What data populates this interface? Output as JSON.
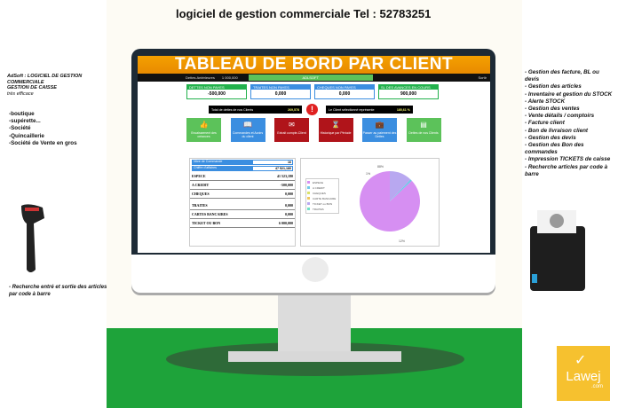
{
  "header": "logiciel de gestion commerciale Tel : 52783251",
  "left": {
    "intro": [
      "AdSoft : LOGICIEL DE GESTION",
      "COMMERCIALE",
      "GESTION DE CAISSE",
      "très efficace"
    ],
    "targets": [
      "-boutique",
      "-supérette...",
      "-Société",
      "-Quincaillerie",
      "-Société de Vente en gros"
    ],
    "scanner_text": "- Recherche  entré et sortie des articles par code à barre"
  },
  "right": {
    "features": [
      "- Gestion des facture, BL ou devis",
      "- Gestion des articles",
      "- Inventaire et gestion du STOCK",
      "- Alerte STOCK",
      "- Gestion des ventes",
      "- Vente détails / comptoirs",
      "- Facture client",
      "- Bon de livraison client",
      "- Gestion des devis",
      "- Gestion des Bon des commandes",
      "- Impression TICKETS de caisse",
      "- Recherche articles par code à barre"
    ]
  },
  "app": {
    "title": "TABLEAU DE BORD PAR CLIENT",
    "bar": {
      "label": "Dettes Antérieures",
      "value": "1 000,000",
      "client": "ADLSOFT",
      "exit": "Sortir"
    },
    "cards": [
      {
        "label": "DETTES NON PAYES",
        "value": "-500,000",
        "color": "#22b14c"
      },
      {
        "label": "TRAITES NON PAYES",
        "value": "0,000",
        "color": "#3b8ee0"
      },
      {
        "label": "CHEQUES NON PAYES",
        "value": "0,000",
        "color": "#3b8ee0"
      },
      {
        "label": "SL DES AVANCES EN COURS",
        "value": "900,000",
        "color": "#22b14c"
      }
    ],
    "total_label": "Total de dettes de nos Clients",
    "total_value": "269,578",
    "pct_label": "Le Client sélectionné représente",
    "pct_value": "185,61 %",
    "tiles": [
      {
        "icon": "thumbs-up",
        "label": "Encaissement des créances",
        "color": "#5cc25a"
      },
      {
        "icon": "book",
        "label": "Commandes et Avoirs du client",
        "color": "#3b8ee0"
      },
      {
        "icon": "envelope",
        "label": "Extrait compte-Client",
        "color": "#b0141a"
      },
      {
        "icon": "history",
        "label": "Historique par Période",
        "color": "#b0141a"
      },
      {
        "icon": "briefcase",
        "label": "Passer au paiement des Dettes",
        "color": "#3b8ee0"
      },
      {
        "icon": "chart",
        "label": "Dettes de nos Clients",
        "color": "#5cc25a"
      }
    ],
    "inputs": [
      {
        "label": "Nbre de Commande",
        "value": "16"
      },
      {
        "label": "Chiffre d'affaires",
        "value": "47 521,180"
      }
    ],
    "rows": [
      {
        "label": "ESPECE",
        "value": "41 523,180"
      },
      {
        "label": "A CREDIT",
        "value": "-500,000"
      },
      {
        "label": "CHEQUES",
        "value": "0,000"
      },
      {
        "label": "TRAITES",
        "value": "0,000"
      },
      {
        "label": "CARTES BANCAIRES",
        "value": "0,000"
      },
      {
        "label": "TICKET OU BON",
        "value": "6 000,000"
      }
    ],
    "chart_data": {
      "type": "pie",
      "categories": [
        "ESPECE",
        "A CREDIT",
        "CHEQUES",
        "CARTE BANCAIRE",
        "TICKET ou BON",
        "TRAITES"
      ],
      "values": [
        87,
        1,
        0,
        0,
        12,
        0
      ],
      "labels": [
        "12%",
        "1%",
        "88%"
      ],
      "colors": [
        "#d68ff2",
        "#6fc9e8",
        "#d9e26a",
        "#f0c75c",
        "#b8a8f0",
        "#6fe0c8"
      ],
      "legend": "left"
    }
  },
  "logo": "Lawej .com"
}
